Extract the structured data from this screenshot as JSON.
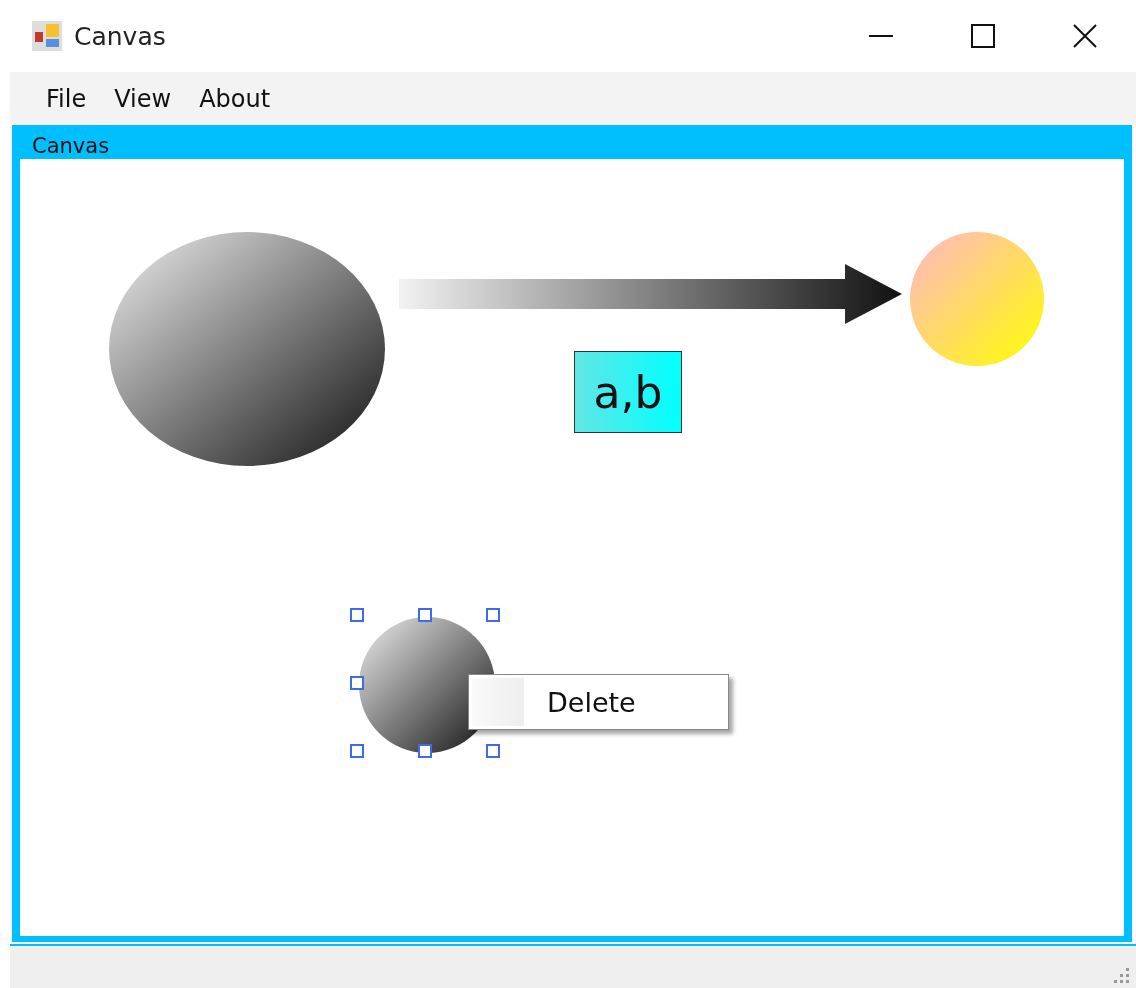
{
  "window": {
    "title": "Canvas"
  },
  "menu": [
    "File",
    "View",
    "About"
  ],
  "group": {
    "title": "Canvas"
  },
  "shapes": [
    {
      "kind": "ellipse",
      "selected": false
    },
    {
      "kind": "arrow",
      "selected": false
    },
    {
      "kind": "warm-circle",
      "selected": false
    },
    {
      "kind": "label",
      "text": "a,b",
      "selected": false
    },
    {
      "kind": "circle",
      "selected": true
    }
  ],
  "context_menu": {
    "items": [
      "Delete"
    ]
  }
}
